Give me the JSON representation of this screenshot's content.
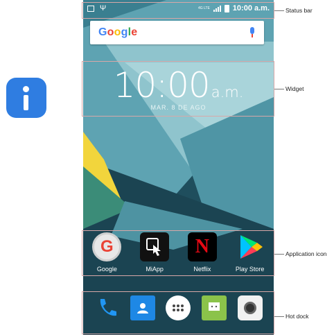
{
  "status_bar": {
    "network": "4G LTE",
    "time": "10:00 a.m."
  },
  "search": {
    "logo": "Google",
    "mic_icon": "mic-icon"
  },
  "widget": {
    "time": "10:00",
    "ampm": "a.m.",
    "date": "MAR. 8 DE AGO"
  },
  "apps": [
    {
      "label": "Google",
      "icon": "google-icon"
    },
    {
      "label": "MiApp",
      "icon": "miapp-icon"
    },
    {
      "label": "Netflix",
      "icon": "netflix-icon"
    },
    {
      "label": "Play Store",
      "icon": "play-store-icon"
    }
  ],
  "dock": [
    {
      "icon": "phone-icon"
    },
    {
      "icon": "contacts-icon"
    },
    {
      "icon": "app-drawer-icon"
    },
    {
      "icon": "messaging-icon"
    },
    {
      "icon": "camera-icon"
    }
  ],
  "callouts": {
    "status_bar": "Status bar",
    "widget": "Widget",
    "application_icon": "Application icon",
    "hot_dock": "Hot dock"
  },
  "colors": {
    "info_icon": "#2f7de1",
    "wallpaper_dark": "#1f4e5d",
    "wallpaper_light": "#8fc4cd",
    "accent_yellow": "#f2d53c"
  }
}
